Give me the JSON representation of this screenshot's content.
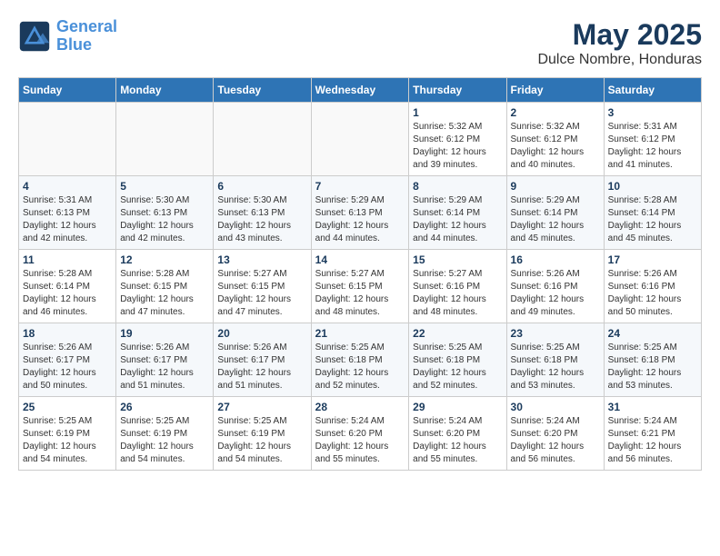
{
  "logo": {
    "line1": "General",
    "line2": "Blue"
  },
  "title": "May 2025",
  "subtitle": "Dulce Nombre, Honduras",
  "days_header": [
    "Sunday",
    "Monday",
    "Tuesday",
    "Wednesday",
    "Thursday",
    "Friday",
    "Saturday"
  ],
  "weeks": [
    [
      {
        "day": "",
        "info": ""
      },
      {
        "day": "",
        "info": ""
      },
      {
        "day": "",
        "info": ""
      },
      {
        "day": "",
        "info": ""
      },
      {
        "day": "1",
        "info": "Sunrise: 5:32 AM\nSunset: 6:12 PM\nDaylight: 12 hours\nand 39 minutes."
      },
      {
        "day": "2",
        "info": "Sunrise: 5:32 AM\nSunset: 6:12 PM\nDaylight: 12 hours\nand 40 minutes."
      },
      {
        "day": "3",
        "info": "Sunrise: 5:31 AM\nSunset: 6:12 PM\nDaylight: 12 hours\nand 41 minutes."
      }
    ],
    [
      {
        "day": "4",
        "info": "Sunrise: 5:31 AM\nSunset: 6:13 PM\nDaylight: 12 hours\nand 42 minutes."
      },
      {
        "day": "5",
        "info": "Sunrise: 5:30 AM\nSunset: 6:13 PM\nDaylight: 12 hours\nand 42 minutes."
      },
      {
        "day": "6",
        "info": "Sunrise: 5:30 AM\nSunset: 6:13 PM\nDaylight: 12 hours\nand 43 minutes."
      },
      {
        "day": "7",
        "info": "Sunrise: 5:29 AM\nSunset: 6:13 PM\nDaylight: 12 hours\nand 44 minutes."
      },
      {
        "day": "8",
        "info": "Sunrise: 5:29 AM\nSunset: 6:14 PM\nDaylight: 12 hours\nand 44 minutes."
      },
      {
        "day": "9",
        "info": "Sunrise: 5:29 AM\nSunset: 6:14 PM\nDaylight: 12 hours\nand 45 minutes."
      },
      {
        "day": "10",
        "info": "Sunrise: 5:28 AM\nSunset: 6:14 PM\nDaylight: 12 hours\nand 45 minutes."
      }
    ],
    [
      {
        "day": "11",
        "info": "Sunrise: 5:28 AM\nSunset: 6:14 PM\nDaylight: 12 hours\nand 46 minutes."
      },
      {
        "day": "12",
        "info": "Sunrise: 5:28 AM\nSunset: 6:15 PM\nDaylight: 12 hours\nand 47 minutes."
      },
      {
        "day": "13",
        "info": "Sunrise: 5:27 AM\nSunset: 6:15 PM\nDaylight: 12 hours\nand 47 minutes."
      },
      {
        "day": "14",
        "info": "Sunrise: 5:27 AM\nSunset: 6:15 PM\nDaylight: 12 hours\nand 48 minutes."
      },
      {
        "day": "15",
        "info": "Sunrise: 5:27 AM\nSunset: 6:16 PM\nDaylight: 12 hours\nand 48 minutes."
      },
      {
        "day": "16",
        "info": "Sunrise: 5:26 AM\nSunset: 6:16 PM\nDaylight: 12 hours\nand 49 minutes."
      },
      {
        "day": "17",
        "info": "Sunrise: 5:26 AM\nSunset: 6:16 PM\nDaylight: 12 hours\nand 50 minutes."
      }
    ],
    [
      {
        "day": "18",
        "info": "Sunrise: 5:26 AM\nSunset: 6:17 PM\nDaylight: 12 hours\nand 50 minutes."
      },
      {
        "day": "19",
        "info": "Sunrise: 5:26 AM\nSunset: 6:17 PM\nDaylight: 12 hours\nand 51 minutes."
      },
      {
        "day": "20",
        "info": "Sunrise: 5:26 AM\nSunset: 6:17 PM\nDaylight: 12 hours\nand 51 minutes."
      },
      {
        "day": "21",
        "info": "Sunrise: 5:25 AM\nSunset: 6:18 PM\nDaylight: 12 hours\nand 52 minutes."
      },
      {
        "day": "22",
        "info": "Sunrise: 5:25 AM\nSunset: 6:18 PM\nDaylight: 12 hours\nand 52 minutes."
      },
      {
        "day": "23",
        "info": "Sunrise: 5:25 AM\nSunset: 6:18 PM\nDaylight: 12 hours\nand 53 minutes."
      },
      {
        "day": "24",
        "info": "Sunrise: 5:25 AM\nSunset: 6:18 PM\nDaylight: 12 hours\nand 53 minutes."
      }
    ],
    [
      {
        "day": "25",
        "info": "Sunrise: 5:25 AM\nSunset: 6:19 PM\nDaylight: 12 hours\nand 54 minutes."
      },
      {
        "day": "26",
        "info": "Sunrise: 5:25 AM\nSunset: 6:19 PM\nDaylight: 12 hours\nand 54 minutes."
      },
      {
        "day": "27",
        "info": "Sunrise: 5:25 AM\nSunset: 6:19 PM\nDaylight: 12 hours\nand 54 minutes."
      },
      {
        "day": "28",
        "info": "Sunrise: 5:24 AM\nSunset: 6:20 PM\nDaylight: 12 hours\nand 55 minutes."
      },
      {
        "day": "29",
        "info": "Sunrise: 5:24 AM\nSunset: 6:20 PM\nDaylight: 12 hours\nand 55 minutes."
      },
      {
        "day": "30",
        "info": "Sunrise: 5:24 AM\nSunset: 6:20 PM\nDaylight: 12 hours\nand 56 minutes."
      },
      {
        "day": "31",
        "info": "Sunrise: 5:24 AM\nSunset: 6:21 PM\nDaylight: 12 hours\nand 56 minutes."
      }
    ]
  ]
}
